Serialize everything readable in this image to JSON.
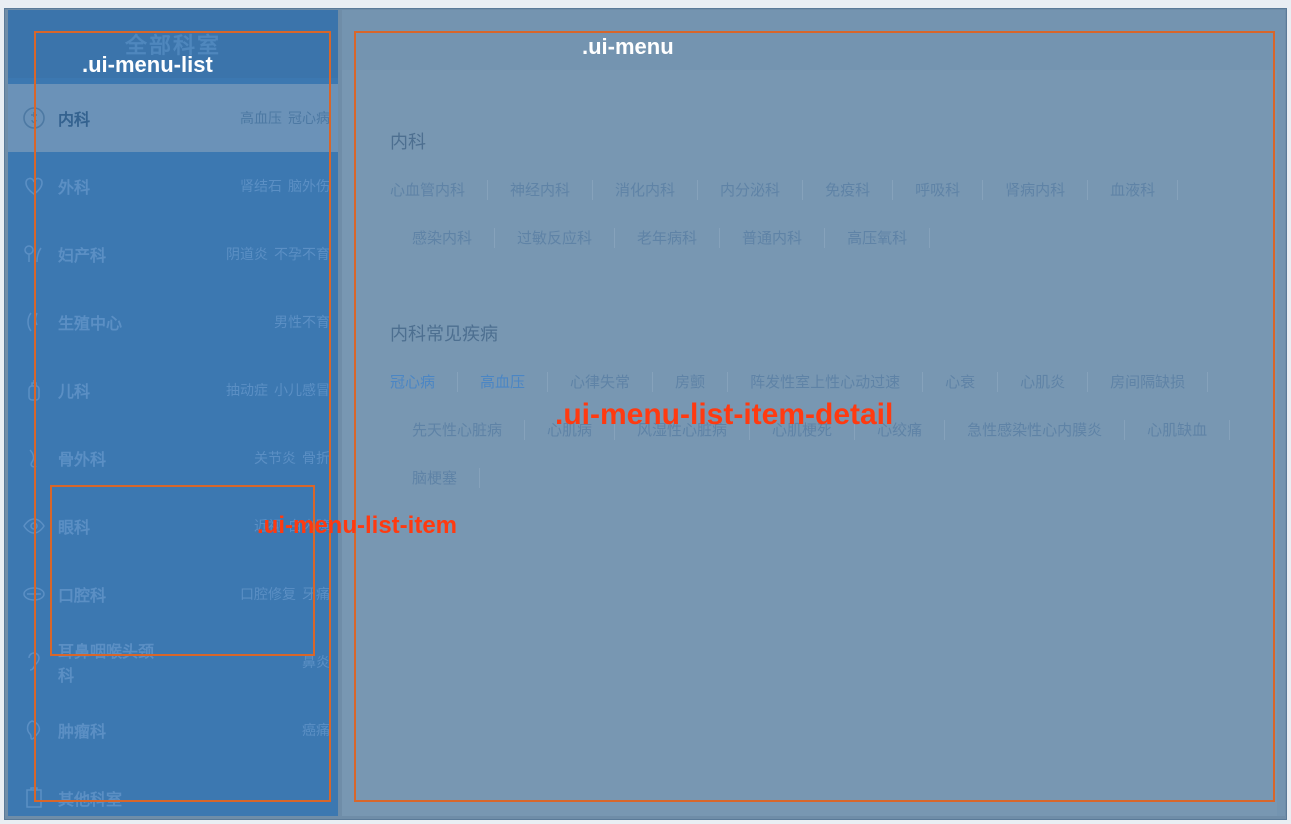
{
  "sidebar": {
    "header": "全部科室",
    "items": [
      {
        "icon": "medical-icon",
        "name": "内科",
        "tags": [
          "高血压",
          "冠心病"
        ],
        "active": true
      },
      {
        "icon": "heart-icon",
        "name": "外科",
        "tags": [
          "肾结石",
          "脑外伤"
        ]
      },
      {
        "icon": "gender-icon",
        "name": "妇产科",
        "tags": [
          "阴道炎",
          "不孕不育"
        ]
      },
      {
        "icon": "reproductive-icon",
        "name": "生殖中心",
        "tags": [
          "男性不育"
        ]
      },
      {
        "icon": "baby-bottle-icon",
        "name": "儿科",
        "tags": [
          "抽动症",
          "小儿感冒"
        ]
      },
      {
        "icon": "bone-icon",
        "name": "骨外科",
        "tags": [
          "关节炎",
          "骨折"
        ]
      },
      {
        "icon": "eye-icon",
        "name": "眼科",
        "tags": [
          "近视",
          "白内障"
        ]
      },
      {
        "icon": "mouth-icon",
        "name": "口腔科",
        "tags": [
          "口腔修复",
          "牙痛"
        ]
      },
      {
        "icon": "ear-icon",
        "name": "耳鼻咽喉头颈科",
        "tags": [
          "鼻炎"
        ]
      },
      {
        "icon": "tumor-icon",
        "name": "肿瘤科",
        "tags": [
          "癌痛"
        ]
      },
      {
        "icon": "clipboard-icon",
        "name": "其他科室",
        "tags": []
      }
    ]
  },
  "detail": {
    "sections": [
      {
        "title": "内科",
        "links": [
          "心血管内科",
          "神经内科",
          "消化内科",
          "内分泌科",
          "免疫科",
          "呼吸科",
          "肾病内科",
          "血液科",
          "感染内科",
          "过敏反应科",
          "老年病科",
          "普通内科",
          "高压氧科"
        ]
      },
      {
        "title": "内科常见疾病",
        "links": [
          "冠心病",
          "高血压",
          "心律失常",
          "房颤",
          "阵发性室上性心动过速",
          "心衰",
          "心肌炎",
          "房间隔缺损",
          "先天性心脏病",
          "心肌病",
          "风湿性心脏病",
          "心肌梗死",
          "心绞痛",
          "急性感染性心内膜炎",
          "心肌缺血",
          "脑梗塞"
        ],
        "hot": [
          "冠心病",
          "高血压"
        ]
      }
    ]
  },
  "annotations": {
    "menu_list": ".ui-menu-list",
    "menu": ".ui-menu",
    "menu_list_item": ".ui-menu-list-item",
    "menu_list_item_detail": ".ui-menu-list-item-detail"
  },
  "colors": {
    "annotation_border": "#d8662a",
    "annotation_red": "#ff3a10",
    "sidebar_bg": "#3c78b1",
    "panel_bg": "#7494b0"
  }
}
